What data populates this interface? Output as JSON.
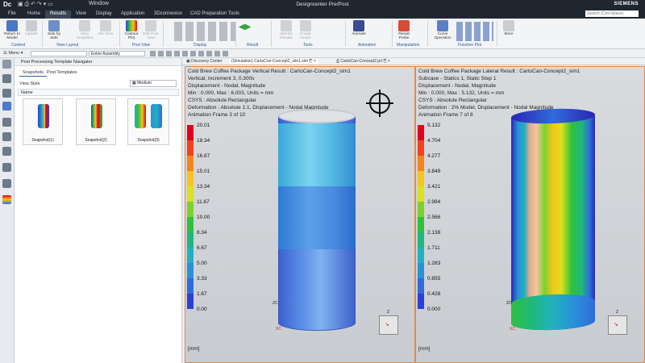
{
  "app": {
    "logo": "Dc",
    "title": "Designcenter Pre/Post",
    "brand": "SIEMENS",
    "window_menu": "Window",
    "search_placeholder": "Search (Ctrl+Space)"
  },
  "tabs": [
    "File",
    "Home",
    "Results",
    "View",
    "Display",
    "Application",
    "3Dconnexion",
    "CAD Preparation Tools"
  ],
  "ribbon": {
    "buttons": {
      "return": "Return to Model",
      "update": "Update",
      "side_by_side": "Side by Side",
      "new_snapshot": "New Snapshot",
      "set_view": "Set View",
      "contour": "Contour Plot",
      "edit_post": "Edit Post View",
      "identify": "Identify Results",
      "create_graph": "Create Graph",
      "animate": "Animate",
      "result_probe": "Result Probe",
      "curve_op": "Curve Operation",
      "more": "More"
    },
    "groups": [
      "Context",
      "View Layout",
      "Post View",
      "Display",
      "Result",
      "Tools",
      "Animation",
      "Manipulation",
      "Function Plot"
    ]
  },
  "selbar": {
    "menu": "Menu",
    "filter": "Entire Assembly"
  },
  "navigator": {
    "title": "Post Processing Template Navigator",
    "tabs": [
      "Snapshots",
      "Post Templates"
    ],
    "view_style_label": "View Style",
    "view_style_value": "Medium",
    "name_col": "Name",
    "snapshots": [
      "Snapshot(1)",
      "Snapshot(2)",
      "Snapshot(3)"
    ]
  },
  "viewport_tabs": [
    "Discovery Center",
    "(Simulation) CartoCan-Concept2_sim1.sim",
    "CartoCan-Concept2.prt"
  ],
  "panes": [
    {
      "lines": [
        "Cold Brew Coffee Package Vertical Result : CartoCan-Concept2_sim1",
        "Vertical, Increment 3, 0.300s",
        "Displacement - Nodal, Magnitude",
        "Min : 0.000, Max : 6.003, Units = mm",
        "CSYS : Absolute Rectangular",
        "Deformation : Absolute 1:1, Displacement - Nodal Magnitude",
        "Animation Frame 3 of 10"
      ],
      "legend": [
        "20.01",
        "18.34",
        "16.67",
        "15.01",
        "13.34",
        "11.67",
        "10.00",
        "8.34",
        "6.67",
        "5.00",
        "3.33",
        "1.67",
        "0.00"
      ],
      "unit": "[mm]"
    },
    {
      "lines": [
        "Cold Brew Coffee Package Lateral Result : CartoCan-Concept2_sim1",
        "Subcase - Statics 1, Static Step 1",
        "Displacement - Nodal, Magnitude",
        "Min : 0.000, Max : 5.132, Units = mm",
        "CSYS : Absolute Rectangular",
        "Deformation : 2% Model, Displacement - Nodal Magnitude",
        "Animation Frame 7 of 8"
      ],
      "legend": [
        "5.132",
        "4.704",
        "4.277",
        "3.849",
        "3.421",
        "2.994",
        "2.566",
        "2.138",
        "1.711",
        "1.283",
        "0.855",
        "0.428",
        "0.000"
      ],
      "unit": "[mm]"
    }
  ],
  "axis_labels": {
    "x": "XC",
    "z": "ZC",
    "y": "YC",
    "xt": "X",
    "zt": "Z"
  },
  "legend_colors": [
    "#e3001b",
    "#f0421c",
    "#f5851a",
    "#f7c51b",
    "#d9e21c",
    "#7fd12a",
    "#2fc03c",
    "#1fb87d",
    "#22b0c0",
    "#2891d8",
    "#2f6bdb",
    "#2d3fd2",
    "#2a25b5"
  ]
}
